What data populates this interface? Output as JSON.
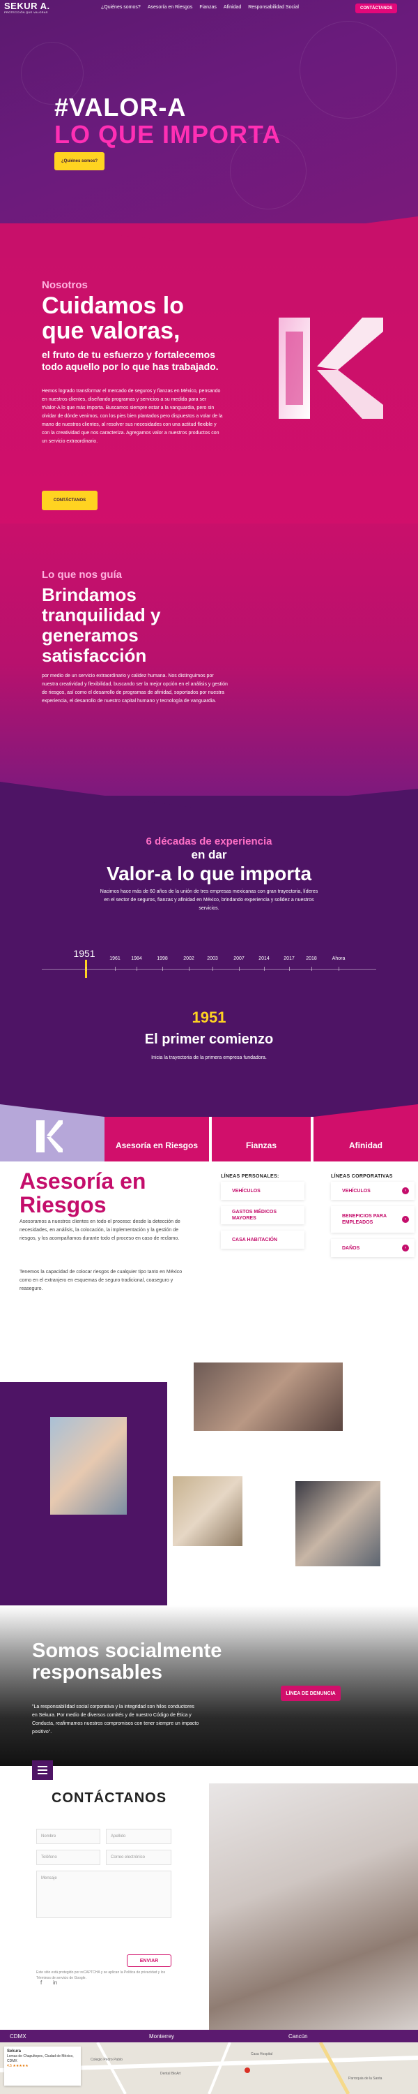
{
  "header": {
    "logo": "SEKUR A.",
    "logo_tag": "PROTECCIÓN QUE VALORAS",
    "nav": [
      "¿Quiénes somos?",
      "Asesoría en Riesgos",
      "Fianzas",
      "Afinidad",
      "Responsabilidad Social"
    ],
    "cta": "CONTÁCTANOS"
  },
  "hero": {
    "title_line1": "#VALOR-A",
    "title_line2": "LO QUE IMPORTA",
    "button": "¿Quiénes somos?"
  },
  "nosotros": {
    "kicker": "Nosotros",
    "title": "Cuidamos lo que valoras,",
    "subtitle": "el fruto de tu esfuerzo y fortalecemos todo aquello por lo que has trabajado.",
    "body": "Hemos logrado transformar el mercado de seguros y fianzas en México, pensando en nuestros clientes, diseñando programas y servicios a su medida para ser #Valor-A lo que más importa. Buscamos siempre estar a la vanguardia, pero sin olvidar de dónde venimos, con los pies bien plantados pero dispuestos a volar de la mano de nuestros clientes, al resolver sus necesidades con una actitud flexible y con la creatividad que nos caracteriza. Agregamos valor a nuestros productos con un servicio extraordinario.",
    "button": "CONTÁCTANOS"
  },
  "guia": {
    "kicker": "Lo que nos guía",
    "title": "Brindamos tranquilidad y generamos satisfacción",
    "body": "por medio de un servicio extraordinario y calidez humana. Nos distinguimos por nuestra creatividad y flexibilidad, buscando ser la mejor opción en el análisis y gestión de riesgos, así como el desarrollo de programas de afinidad, soportados por nuestra experiencia, el desarrollo de nuestro capital humano y tecnología de vanguardia."
  },
  "historia": {
    "kicker": "6 décadas de experiencia",
    "title1": "en dar",
    "title2": "Valor-a lo que importa",
    "body": "Nacimos hace más de 60 años de la unión de tres empresas mexicanas con gran trayectoria, líderes en el sector de seguros, fianzas y afinidad en México, brindando experiencia y solidez a nuestros servicios.",
    "years": [
      "1951",
      "1961",
      "1984",
      "1998",
      "2002",
      "2003",
      "2007",
      "2014",
      "2017",
      "2018",
      "Ahora"
    ],
    "selected_year": "1951",
    "selected_heading": "El primer comienzo",
    "selected_text": "Inicia la trayectoria de la primera empresa fundadora."
  },
  "tabs": [
    "Asesoría en Riesgos",
    "Fianzas",
    "Afinidad"
  ],
  "asesoria": {
    "title": "Asesoría en Riesgos",
    "body1": "Asesoramos a nuestros clientes en todo el proceso: desde la detección de necesidades, en análisis, la colocación, la implementación y la gestión de riesgos, y los acompañamos durante todo el proceso en caso de reclamo.",
    "body2": "Tenemos la capacidad de colocar riesgos de cualquier tipo tanto en México como en el extranjero en esquemas de seguro tradicional, coaseguro y reaseguro.",
    "personal_head": "LÍNEAS PERSONALES:",
    "personal": [
      "VEHÍCULOS",
      "GASTOS MÉDICOS MAYORES",
      "CASA HABITACIÓN"
    ],
    "corporate_head": "LÍNEAS CORPORATIVAS",
    "corporate": [
      "VEHÍCULOS",
      "BENEFICIOS PARA EMPLEADOS",
      "DAÑOS"
    ]
  },
  "social": {
    "title": "Somos socialmente responsables",
    "quote": "\"La responsabilidad social corporativa y la integridad son hilos conductores en Sekura. Por medio de diversos comités y de nuestro Código de Ética y Conducta, reafirmamos nuestros compromisos con tener siempre un impacto positivo\".",
    "button": "LÍNEA DE DENUNCIA"
  },
  "contact": {
    "title": "CONTÁCTANOS",
    "fields": [
      "Nombre",
      "Apellido",
      "Teléfono",
      "Correo electrónico",
      "Mensaje"
    ],
    "note": "Este sitio está protegido por reCAPTCHA y se aplican la Política de privacidad y los Términos de servicio de Google.",
    "send": "ENVIAR",
    "social": [
      "f",
      "in"
    ]
  },
  "footer": {
    "cities": [
      "CDMX",
      "Monterrey",
      "Cancún"
    ],
    "map_card_title": "Sekura",
    "map_card_text": "Lomas de Chapultepec, Ciudad de México, CDMX",
    "map_card_rating": "4.5 ★★★★★",
    "map_labels": [
      "Colegio Pedro Pablo",
      "Dental BioArt",
      "Casa Hospital",
      "Parroquia de la Santa"
    ]
  },
  "colors": {
    "purple": "#5b1a6f",
    "magenta": "#d10f6b",
    "yellow": "#ffd321"
  }
}
